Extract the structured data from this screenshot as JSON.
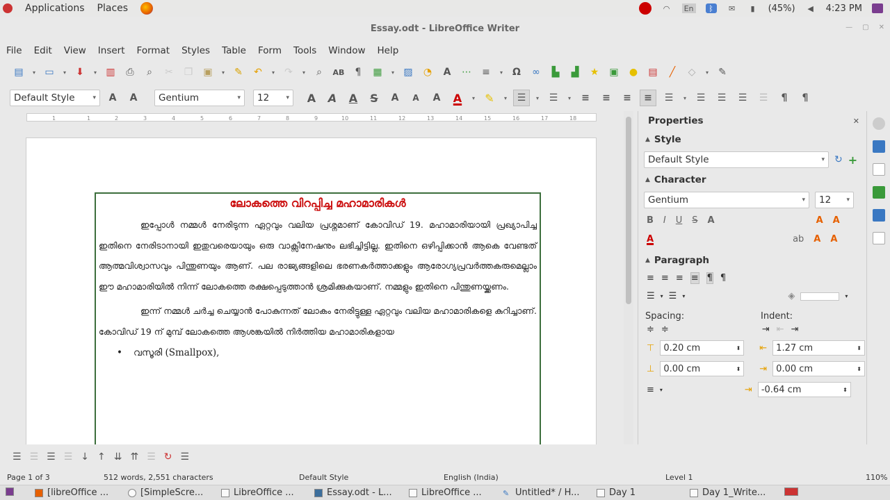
{
  "topbar": {
    "applications": "Applications",
    "places": "Places",
    "lang": "En",
    "battery": "(45%)",
    "clock": "4:23 PM"
  },
  "window": {
    "title": "Essay.odt - LibreOffice Writer"
  },
  "menu": [
    "File",
    "Edit",
    "View",
    "Insert",
    "Format",
    "Styles",
    "Table",
    "Form",
    "Tools",
    "Window",
    "Help"
  ],
  "formatting": {
    "paragraph_style": "Default Style",
    "font_name": "Gentium",
    "font_size": "12"
  },
  "ruler_ticks": [
    "1",
    "1",
    "2",
    "3",
    "4",
    "5",
    "6",
    "7",
    "8",
    "9",
    "10",
    "11",
    "12",
    "13",
    "14",
    "15",
    "16",
    "17",
    "18"
  ],
  "document": {
    "title": "ലോകത്തെ വിറപ്പിച്ച മഹാമാരികൾ",
    "paragraph1": "ഇപ്പോൾ നമ്മൾ നേരിടുന്ന ഏറ്റവും വലിയ പ്രശ്നമാണ് കോവിഡ് 19. മഹാമാരിയായി പ്രഖ്യാപിച്ച ഇതിനെ നേരിടാനായി ഇതുവരെയായും ഒരു വാക്സിനേഷനും ലഭിച്ചിട്ടില്ല. ഇതിനെ ഒഴിപ്പിക്കാൻ ആകെ വേണ്ടത് ആത്മവിശ്വാസവും പിന്തുണയും ആണ്. പല രാജ്യങ്ങളിലെ ഭരണകർത്താക്കളും ആരോഗ്യപ്രവർത്തകരുമെല്ലാം ഈ മഹാമാരിയിൽ നിന്ന് ലോകത്തെ രക്ഷപ്പെടുത്താൻ ശ്രമിക്കുകയാണ്. നമ്മളും ഇതിനെ പിന്തുണയ്ക്കണം.",
    "paragraph2": "ഇന്ന് നമ്മൾ ചർച്ച ചെയ്യാൻ പോകുന്നത് ലോകം നേരിട്ടുള്ള ഏറ്റവും വലിയ മഹാമാരികളെ കുറിച്ചാണ്. കോവിഡ് 19 ന് മുമ്പ് ലോകത്തെ ആശങ്കയിൽ നിർത്തിയ മഹാമാരികളായ",
    "bullet1": "വസൂരി (Smallpox),"
  },
  "sidebar": {
    "title": "Properties",
    "style_section": "Style",
    "style_value": "Default Style",
    "character_section": "Character",
    "font_name": "Gentium",
    "font_size": "12",
    "paragraph_section": "Paragraph",
    "spacing_label": "Spacing:",
    "indent_label": "Indent:",
    "spacing_above": "0.20 cm",
    "spacing_below": "0.00 cm",
    "indent_before": "1.27 cm",
    "indent_after": "0.00 cm",
    "indent_first": "-0.64 cm"
  },
  "status": {
    "page": "Page 1 of 3",
    "words": "512 words, 2,551 characters",
    "style": "Default Style",
    "language": "English (India)",
    "level": "Level 1",
    "zoom": "110%"
  },
  "taskbar": [
    "[libreOffice ...",
    "[SimpleScre...",
    "LibreOffice ...",
    "Essay.odt - L...",
    "LibreOffice ...",
    "Untitled* / H...",
    "Day 1",
    "Day 1_Write..."
  ]
}
